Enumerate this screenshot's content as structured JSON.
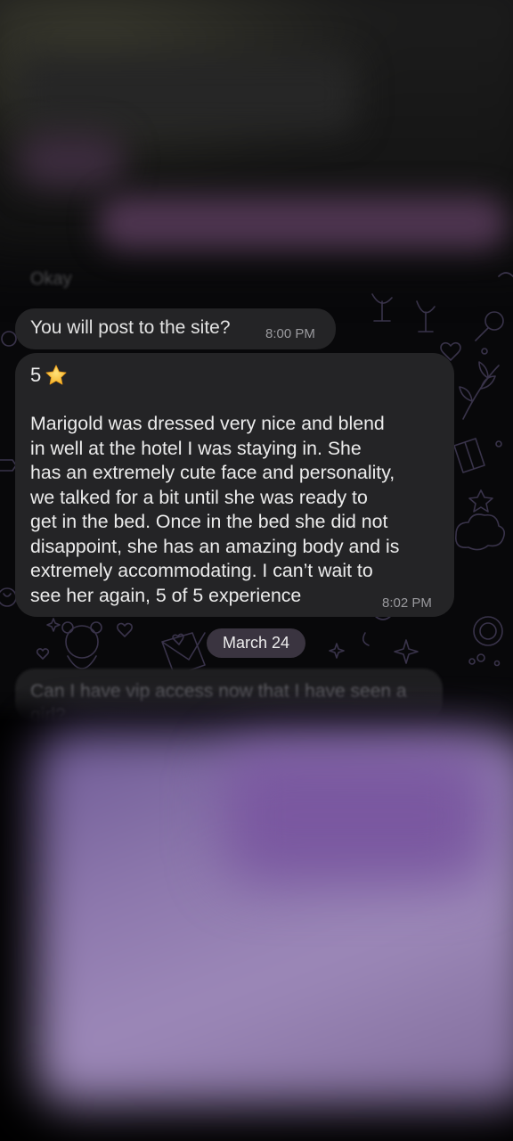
{
  "chat": {
    "blurred_previous": {
      "partial_label": "Okay"
    },
    "messages": [
      {
        "text": "You will post to the site?",
        "time": "8:00 PM"
      },
      {
        "rating": "5",
        "rating_icon": "star-icon",
        "body": "Marigold was dressed very nice and blend\nin well at the hotel I was staying in. She\nhas an extremely cute face and personality,\nwe talked for a bit until she was ready to\nget in the bed.  Once in the bed she did not\ndisappoint, she has an amazing body and is\nextremely accommodating.  I can’t wait to\nsee her again, 5 of 5 experience",
        "time": "8:02 PM"
      }
    ],
    "date_separator": "March 24",
    "blurred_next": {
      "text": "Can I have vip access now that I have seen a girl?"
    }
  },
  "colors": {
    "bubble": "#242426",
    "date_chip": "#3a3440",
    "background": "#08080a",
    "purple_attachment": "#8d78ad"
  }
}
